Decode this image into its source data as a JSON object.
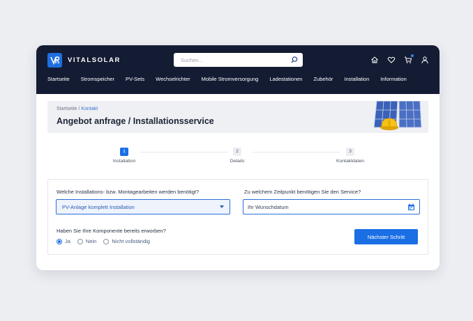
{
  "brand": {
    "name": "VITALSOLAR",
    "accent": "#1a6fe5",
    "header_bg": "#141c34"
  },
  "search": {
    "placeholder": "Suchen..."
  },
  "header_icons": [
    "home-icon",
    "heart-icon",
    "cart-icon",
    "user-icon"
  ],
  "nav": {
    "items": [
      {
        "label": "Startseite"
      },
      {
        "label": "Stromspeicher"
      },
      {
        "label": "PV-Sets"
      },
      {
        "label": "Wechselrichter"
      },
      {
        "label": "Mobile Stromversorgung"
      },
      {
        "label": "Ladestationen"
      },
      {
        "label": "Zubehör"
      },
      {
        "label": "Installation"
      },
      {
        "label": "Information"
      }
    ]
  },
  "breadcrumb": {
    "home": "Startseite",
    "separator": " / ",
    "current": "Kontakt"
  },
  "page": {
    "title": "Angebot anfrage / Installationsservice"
  },
  "stepper": {
    "steps": [
      {
        "num": "1",
        "label": "Installation",
        "active": true
      },
      {
        "num": "2",
        "label": "Details",
        "active": false
      },
      {
        "num": "3",
        "label": "Kontaktdaten",
        "active": false
      }
    ]
  },
  "form": {
    "work_label": "Welche Installations- bzw. Montagearbeiten werden benötigt?",
    "work_value": "PV-Anlage komplett Installation",
    "date_label": "Zu welchem Zeitpunkt benötigen Sie den Service?",
    "date_placeholder": "Ihr Wunschdatum",
    "acquired_label": "Haben Sie Ihre Komponente bereits erworben?",
    "options": [
      {
        "label": "Ja",
        "checked": true
      },
      {
        "label": "Nein",
        "checked": false
      },
      {
        "label": "Nicht vollständig",
        "checked": false
      }
    ],
    "next_button": "Nächster Schritt"
  }
}
